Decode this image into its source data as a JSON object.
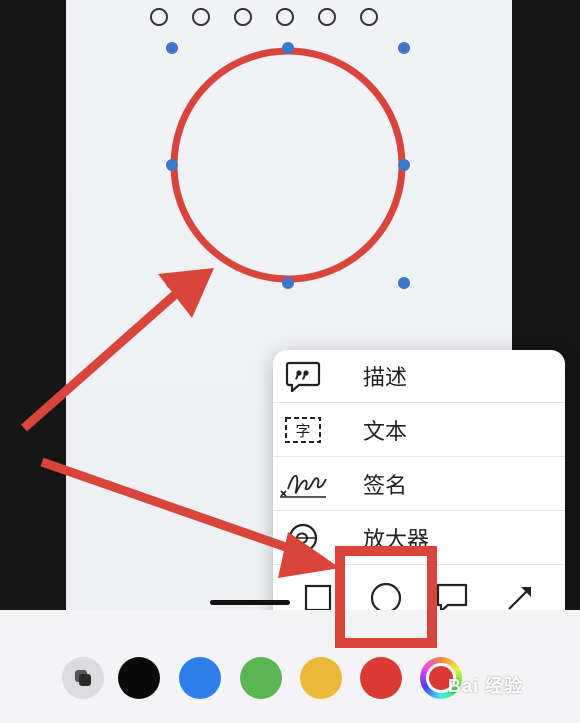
{
  "menu": {
    "items": [
      {
        "label": "描述",
        "icon": "speech-quote-icon"
      },
      {
        "label": "文本",
        "icon": "text-box-icon"
      },
      {
        "label": "签名",
        "icon": "signature-icon"
      },
      {
        "label": "放大器",
        "icon": "magnifier-icon"
      }
    ],
    "text_icon_glyph": "字"
  },
  "shapes": [
    {
      "name": "square-shape-icon"
    },
    {
      "name": "circle-shape-icon",
      "selected": true
    },
    {
      "name": "speech-bubble-shape-icon"
    },
    {
      "name": "arrow-shape-icon"
    }
  ],
  "colors": {
    "black": "#0a0a0a",
    "blue": "#2f7fe8",
    "green": "#5ab552",
    "yellow": "#ebb83a",
    "red": "#d93a33",
    "annotation_red": "#d9453b",
    "handle_blue": "#3d77c9"
  },
  "watermark": "Bai 经验"
}
